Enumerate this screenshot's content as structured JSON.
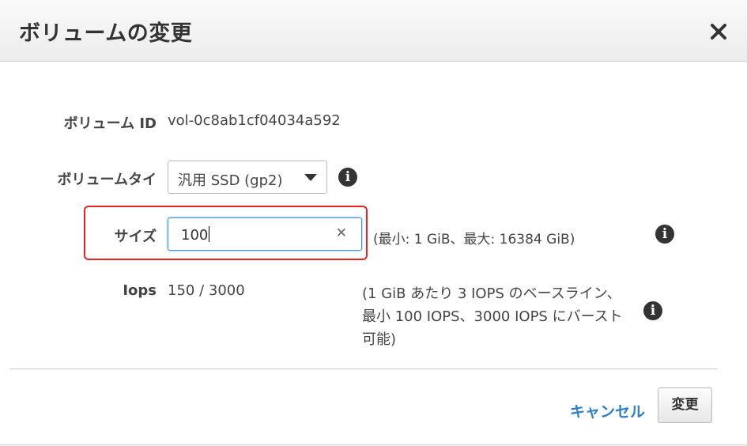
{
  "dialog": {
    "title": "ボリュームの変更",
    "close_icon": "close-icon"
  },
  "fields": {
    "volume_id": {
      "label": "ボリューム ID",
      "value": "vol-0c8ab1cf04034a592"
    },
    "volume_type": {
      "label": "ボリュームタイ",
      "selected": "汎用 SSD (gp2)",
      "info_icon": "info-icon"
    },
    "size": {
      "label": "サイズ",
      "value": "100",
      "clear_icon": "close-icon",
      "hint": "(最小: 1 GiB、最大: 16384 GiB)",
      "info_icon": "info-icon"
    },
    "iops": {
      "label": "Iops",
      "value": "150 / 3000",
      "note": "(1 GiB あたり 3 IOPS のベースライン、最小 100 IOPS、3000 IOPS にバースト可能)",
      "info_icon": "info-icon"
    }
  },
  "footer": {
    "cancel_label": "キャンセル",
    "submit_label": "変更"
  },
  "colors": {
    "link": "#2f7fc7",
    "highlight_border": "#e32424",
    "focus_border": "#3b8ede"
  }
}
